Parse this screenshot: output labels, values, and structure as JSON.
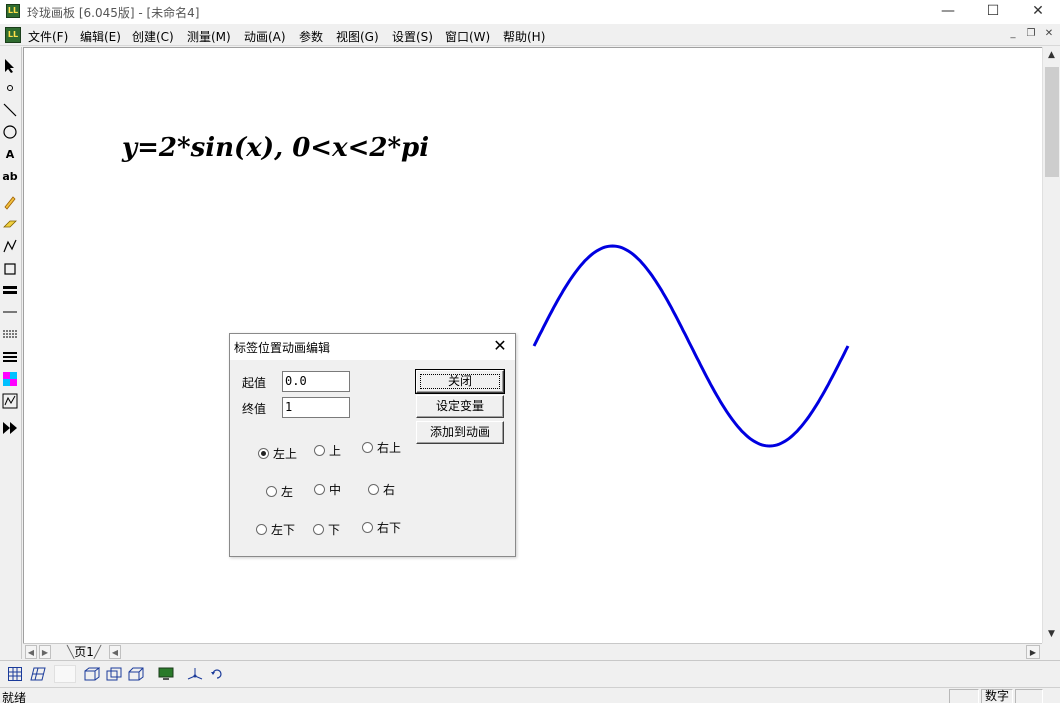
{
  "window": {
    "title": "玲珑画板 [6.045版] - [未命名4]",
    "app_icon_text": "LL",
    "minimize": "—",
    "maximize": "☐",
    "close": "✕"
  },
  "menubar": {
    "items": [
      {
        "label": "文件(F)"
      },
      {
        "label": "编辑(E)"
      },
      {
        "label": "创建(C)"
      },
      {
        "label": "测量(M)"
      },
      {
        "label": "动画(A)"
      },
      {
        "label": "参数"
      },
      {
        "label": "视图(G)"
      },
      {
        "label": "设置(S)"
      },
      {
        "label": "窗口(W)"
      },
      {
        "label": "帮助(H)"
      }
    ],
    "mdi_min": "_",
    "mdi_restore": "❐",
    "mdi_close": "✕"
  },
  "left_toolbar": {
    "text_tool": "A",
    "label_tool": "ab"
  },
  "canvas": {
    "formula": "y=2*sin(x), 0<x<2*pi",
    "curve_color": "#0000e0"
  },
  "tabs": {
    "page_label": "页1"
  },
  "dialog": {
    "title": "标签位置动画编辑",
    "start_label": "起值",
    "start_value": "0.0",
    "end_label": "终值",
    "end_value": "1",
    "buttons": {
      "close": "关闭",
      "set_var": "设定变量",
      "add_anim": "添加到动画"
    },
    "positions": {
      "top_left": "左上",
      "top": "上",
      "top_right": "右上",
      "left": "左",
      "center": "中",
      "right": "右",
      "bottom_left": "左下",
      "bottom": "下",
      "bottom_right": "右下"
    },
    "selected_position": "top_left"
  },
  "statusbar": {
    "text": "就绪",
    "num_label": "数字"
  }
}
